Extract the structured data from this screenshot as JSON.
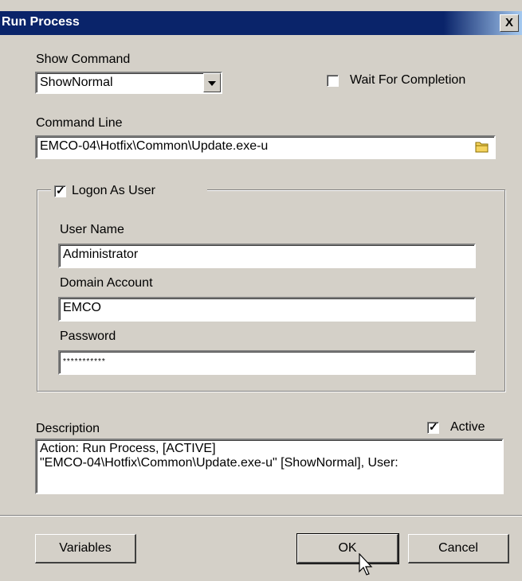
{
  "window": {
    "title": "Run Process",
    "close_glyph": "X"
  },
  "show_command": {
    "label": "Show Command",
    "selected": "ShowNormal"
  },
  "wait_for_completion": {
    "label": "Wait For Completion",
    "checked": false
  },
  "command_line": {
    "label": "Command Line",
    "value": "EMCO-04\\Hotfix\\Common\\Update.exe-u",
    "browse_icon": "folder-icon"
  },
  "logon": {
    "label": "Logon As User",
    "checked": true,
    "user_name": {
      "label": "User Name",
      "value": "Administrator"
    },
    "domain_account": {
      "label": "Domain Account",
      "value": "EMCO"
    },
    "password": {
      "label": "Password",
      "value": "***********"
    }
  },
  "description": {
    "label": "Description",
    "line1": "Action: Run Process, [ACTIVE]",
    "line2": "\"EMCO-04\\Hotfix\\Common\\Update.exe-u\" [ShowNormal], User:"
  },
  "active": {
    "label": "Active",
    "checked": true
  },
  "buttons": {
    "variables": "Variables",
    "ok": "OK",
    "cancel": "Cancel"
  }
}
